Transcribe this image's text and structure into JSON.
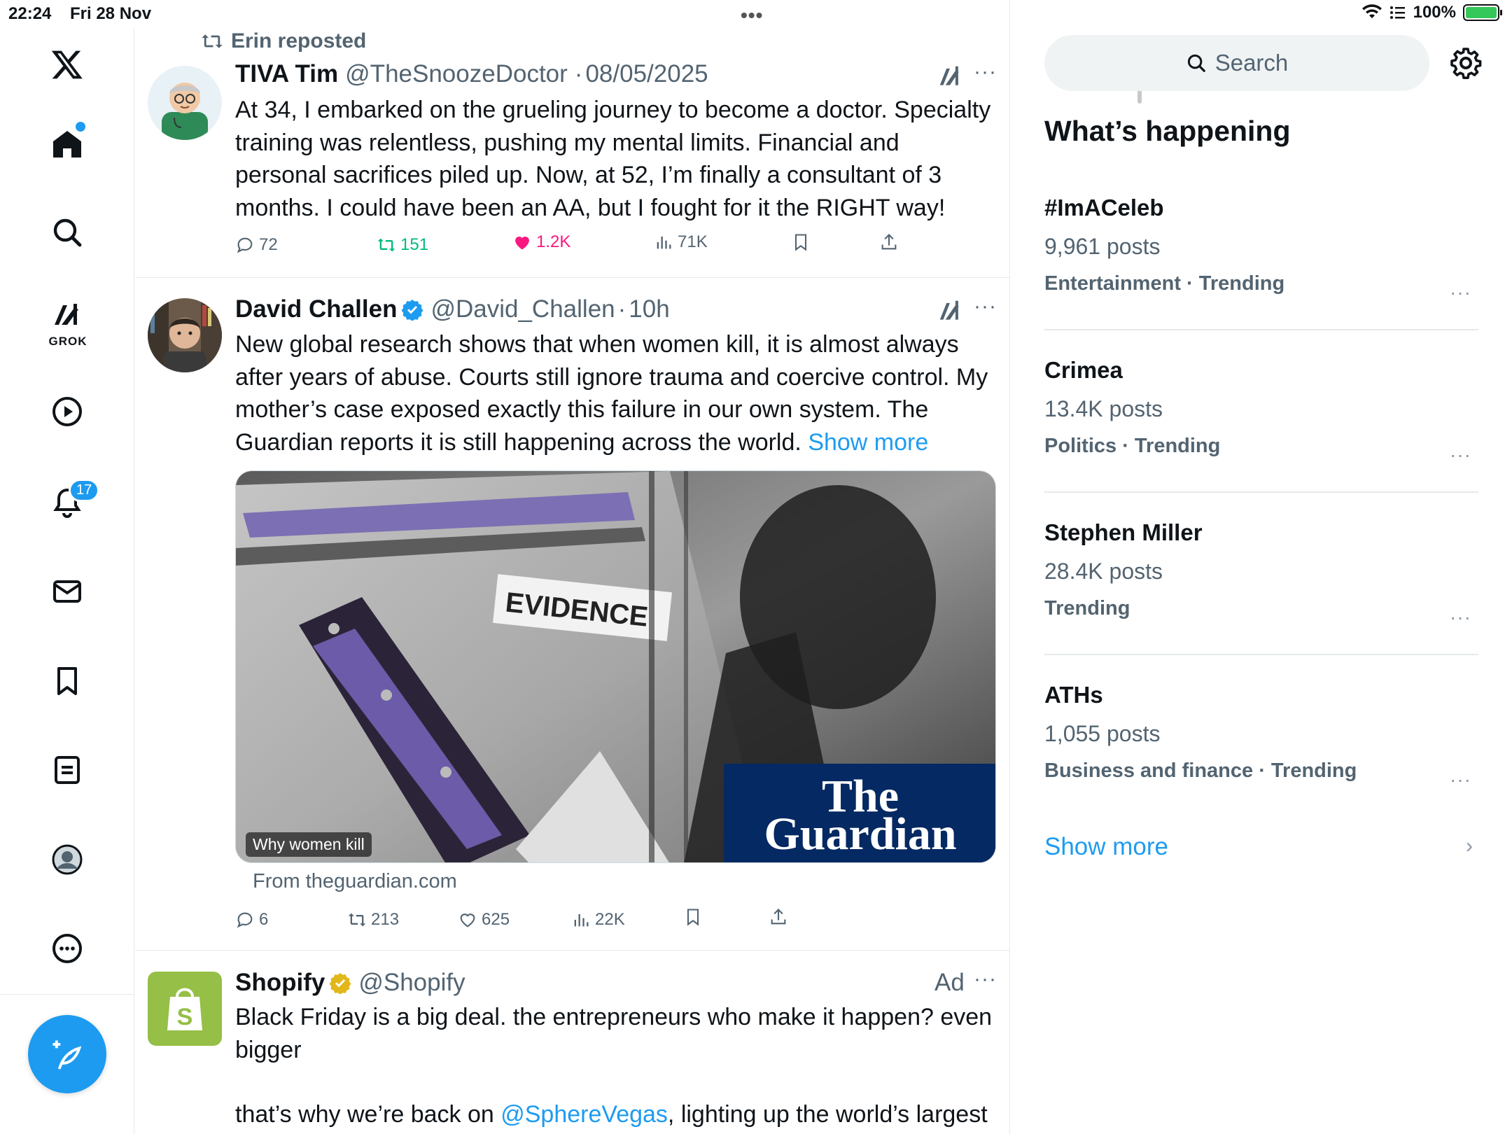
{
  "status_bar": {
    "time": "22:24",
    "date": "Fri 28 Nov",
    "battery": "100%"
  },
  "nav": {
    "grok_label": "GROK",
    "notifications_badge": "17"
  },
  "feed": {
    "tweet1": {
      "repost_text": "Erin reposted",
      "name": "TIVA Tim",
      "handle": "@TheSnoozeDoctor",
      "sep": "·",
      "time": "08/05/2025",
      "body": "At 34, I embarked on the grueling journey to become a doctor. Specialty training was relentless, pushing my mental limits. Financial and personal sacrifices piled up. Now, at 52, I’m finally a consultant of 3 months. I could have been an AA, but I fought for it the RIGHT way!",
      "replies": "72",
      "reposts": "151",
      "likes": "1.2K",
      "views": "71K"
    },
    "tweet2": {
      "name": "David Challen",
      "handle": "@David_Challen",
      "sep": "·",
      "time": "10h",
      "body": "New global research shows that when women kill, it is almost always after years of abuse. Courts still ignore trauma and coercive control. My mother’s case exposed exactly this failure in our own system. The Guardian reports it is still happening across the world.",
      "show_more": "Show more",
      "media_label": "EVIDENCE",
      "media_brand_line1": "The",
      "media_brand_line2": "Guardian",
      "media_caption": "Why women kill",
      "from": "From theguardian.com",
      "replies": "6",
      "reposts": "213",
      "likes": "625",
      "views": "22K"
    },
    "tweet3": {
      "name": "Shopify",
      "handle": "@Shopify",
      "ad": "Ad",
      "body_line1": "Black Friday is a big deal. the entrepreneurs who make it happen? even bigger",
      "body_line2_pre": "that’s why we’re back on ",
      "body_line2_link": "@SphereVegas",
      "body_line2_post": ", lighting up the world’s largest"
    }
  },
  "sidebar": {
    "search_placeholder": "Search",
    "title": "What’s happening",
    "trends": [
      {
        "title": "#ImACeleb",
        "posts": "9,961 posts",
        "category": "Entertainment · Trending"
      },
      {
        "title": "Crimea",
        "posts": "13.4K posts",
        "category": "Politics · Trending"
      },
      {
        "title": "Stephen Miller",
        "posts": "28.4K posts",
        "category": "Trending"
      },
      {
        "title": "ATHs",
        "posts": "1,055 posts",
        "category": "Business and finance · Trending"
      }
    ],
    "show_more": "Show more"
  },
  "colors": {
    "accent": "#1d9bf0",
    "like": "#f91880",
    "repost": "#00ba7c",
    "muted": "#536471"
  }
}
